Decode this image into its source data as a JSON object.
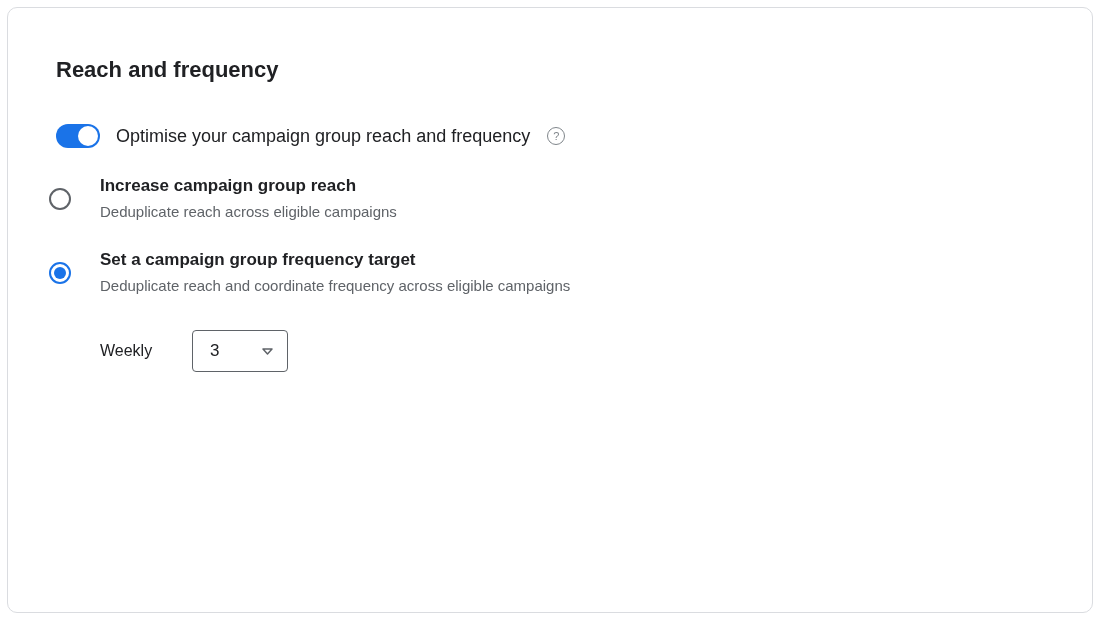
{
  "card": {
    "title": "Reach and frequency"
  },
  "optimise": {
    "label": "Optimise your campaign group reach and frequency",
    "on": true,
    "help": "?"
  },
  "options": [
    {
      "title": "Increase campaign group reach",
      "description": "Deduplicate reach across eligible campaigns",
      "selected": false
    },
    {
      "title": "Set a campaign group frequency target",
      "description": "Deduplicate reach and coordinate frequency across eligible campaigns",
      "selected": true
    }
  ],
  "frequency": {
    "label": "Weekly",
    "value": "3"
  }
}
